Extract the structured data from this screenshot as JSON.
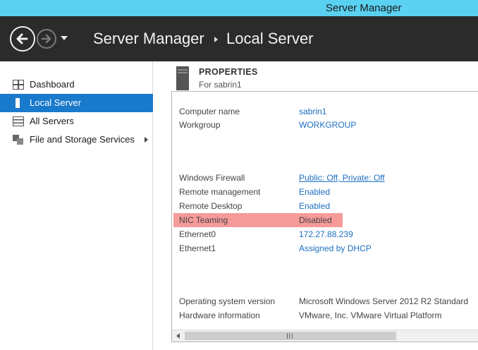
{
  "window": {
    "title": "Server Manager"
  },
  "header": {
    "breadcrumb_root": "Server Manager",
    "breadcrumb_current": "Local Server"
  },
  "sidebar": {
    "items": [
      {
        "label": "Dashboard",
        "icon": "dashboard-grid-icon",
        "active": false
      },
      {
        "label": "Local Server",
        "icon": "server-icon",
        "active": true
      },
      {
        "label": "All Servers",
        "icon": "servers-list-icon",
        "active": false
      },
      {
        "label": "File and Storage Services",
        "icon": "storage-icon",
        "active": false
      }
    ]
  },
  "properties": {
    "title": "PROPERTIES",
    "subtitle": "For sabrin1",
    "rows": [
      {
        "key": "Computer name",
        "value": "sabrin1"
      },
      {
        "key": "Workgroup",
        "value": "WORKGROUP"
      },
      {
        "key": "Windows Firewall",
        "value": "Public: Off, Private: Off"
      },
      {
        "key": "Remote management",
        "value": "Enabled"
      },
      {
        "key": "Remote Desktop",
        "value": "Enabled"
      },
      {
        "key": "NIC Teaming",
        "value": "Disabled"
      },
      {
        "key": "Ethernet0",
        "value": "172.27.88.239"
      },
      {
        "key": "Ethernet1",
        "value": "Assigned by DHCP"
      },
      {
        "key": "Operating system version",
        "value": "Microsoft Windows Server 2012 R2 Standard"
      },
      {
        "key": "Hardware information",
        "value": "VMware, Inc. VMware Virtual Platform"
      }
    ]
  },
  "colors": {
    "titlebar": "#5ad1f0",
    "header": "#2b2b2b",
    "active_nav": "#1979ca",
    "link": "#1c6fc2",
    "highlight": "#f69a9a"
  }
}
